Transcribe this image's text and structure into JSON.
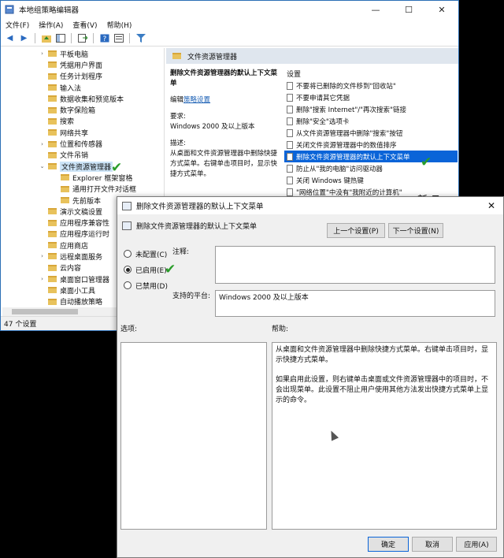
{
  "window": {
    "title": "本地组策略编辑器",
    "menu": [
      "文件(F)",
      "操作(A)",
      "查看(V)",
      "帮助(H)"
    ],
    "controls": {
      "minimize": "—",
      "maximize": "☐",
      "close": "✕"
    }
  },
  "tree": {
    "items": [
      {
        "label": "平板电脑",
        "expander": "›"
      },
      {
        "label": "凭据用户界面",
        "expander": ""
      },
      {
        "label": "任务计划程序",
        "expander": ""
      },
      {
        "label": "输入法",
        "expander": ""
      },
      {
        "label": "数据收集和预览版本",
        "expander": ""
      },
      {
        "label": "数字保险箱",
        "expander": ""
      },
      {
        "label": "搜索",
        "expander": ""
      },
      {
        "label": "网络共享",
        "expander": ""
      },
      {
        "label": "位置和传感器",
        "expander": "›"
      },
      {
        "label": "文件吊销",
        "expander": ""
      },
      {
        "label": "文件资源管理器",
        "expander": "⌄",
        "selected": true
      },
      {
        "label": "Explorer 框架窗格",
        "expander": "",
        "indent": true
      },
      {
        "label": "通用打开文件对话框",
        "expander": "",
        "indent": true
      },
      {
        "label": "先前版本",
        "expander": "",
        "indent": true
      },
      {
        "label": "演示文稿设置",
        "expander": ""
      },
      {
        "label": "应用程序兼容性",
        "expander": ""
      },
      {
        "label": "应用程序运行时",
        "expander": ""
      },
      {
        "label": "应用商店",
        "expander": ""
      },
      {
        "label": "远程桌面服务",
        "expander": "›"
      },
      {
        "label": "云内容",
        "expander": ""
      },
      {
        "label": "桌面窗口管理器",
        "expander": "›"
      },
      {
        "label": "桌面小工具",
        "expander": ""
      },
      {
        "label": "自动播放策略",
        "expander": ""
      }
    ]
  },
  "status": "47 个设置",
  "right_pane": {
    "header": "文件资源管理器",
    "desc_title": "删除文件资源管理器的默认上下文菜单",
    "edit_prefix": "编辑",
    "edit_link": "策略设置",
    "req_label": "要求:",
    "req_value": "Windows 2000 及以上版本",
    "desc_label": "描述:",
    "desc_text": "从桌面和文件资源管理器中删除快捷方式菜单。右键单击项目时，显示快捷方式菜单。",
    "list_header": "设置",
    "settings": [
      {
        "label": "不要将已删除的文件移到\"回收站\""
      },
      {
        "label": "不要申请其它凭据"
      },
      {
        "label": "删除\"搜索 Internet\"/\"再次搜索\"链接"
      },
      {
        "label": "删除\"安全\"选项卡"
      },
      {
        "label": "从文件资源管理器中删除\"搜索\"按钮"
      },
      {
        "label": "关闭文件资源管理器中的数值排序"
      },
      {
        "label": "删除文件资源管理器的默认上下文菜单",
        "selected": true
      },
      {
        "label": "防止从\"我的电脑\"访问驱动器"
      },
      {
        "label": "关闭 Windows 键热键"
      },
      {
        "label": "\"网络位置\"中没有\"我附近的计算机\""
      }
    ]
  },
  "logo_text": "新 Tec",
  "dialog": {
    "title": "删除文件资源管理器的默认上下文菜单",
    "subtitle": "删除文件资源管理器的默认上下文菜单",
    "close": "✕",
    "prev_btn": "上一个设置(P)",
    "next_btn": "下一个设置(N)",
    "radios": [
      {
        "label": "未配置(C)",
        "checked": false
      },
      {
        "label": "已启用(E)",
        "checked": true
      },
      {
        "label": "已禁用(D)",
        "checked": false
      }
    ],
    "comment_label": "注释:",
    "platform_label": "支持的平台:",
    "platform_value": "Windows 2000 及以上版本",
    "options_label": "选项:",
    "help_label": "帮助:",
    "help_p1": "从桌面和文件资源管理器中删除快捷方式菜单。右键单击项目时，显示快捷方式菜单。",
    "help_p2": "如果启用此设置，则右键单击桌面或文件资源管理器中的项目时，不会出现菜单。此设置不阻止用户使用其他方法发出快捷方式菜单上显示的命令。",
    "ok_btn": "确定",
    "cancel_btn": "取消",
    "apply_btn": "应用(A)"
  },
  "check_mark": "✔"
}
